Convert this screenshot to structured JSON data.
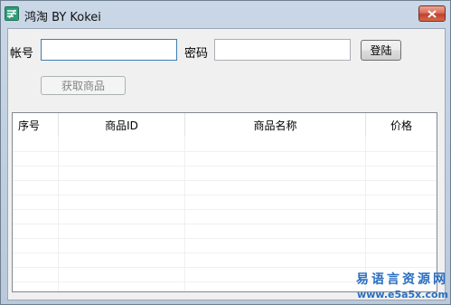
{
  "window": {
    "title": "鸿淘 BY Kokei",
    "close_icon": "close-x-icon",
    "app_icon": "app-logo-icon"
  },
  "form": {
    "account_label": "帐号",
    "account_value": "",
    "password_label": "密码",
    "password_value": "",
    "login_button": "登陆",
    "fetch_button": "获取商品",
    "fetch_enabled": false
  },
  "table": {
    "columns": [
      "序号",
      "商品ID",
      "商品名称",
      "价格"
    ],
    "rows": []
  },
  "watermark": {
    "text": "易语言资源网",
    "url": "www.e5a5x.com"
  },
  "colors": {
    "title_bar": "#c3d2e2",
    "close_button": "#c9503a",
    "watermark": "#2a6fc1",
    "focus_border": "#3c7fb1"
  }
}
